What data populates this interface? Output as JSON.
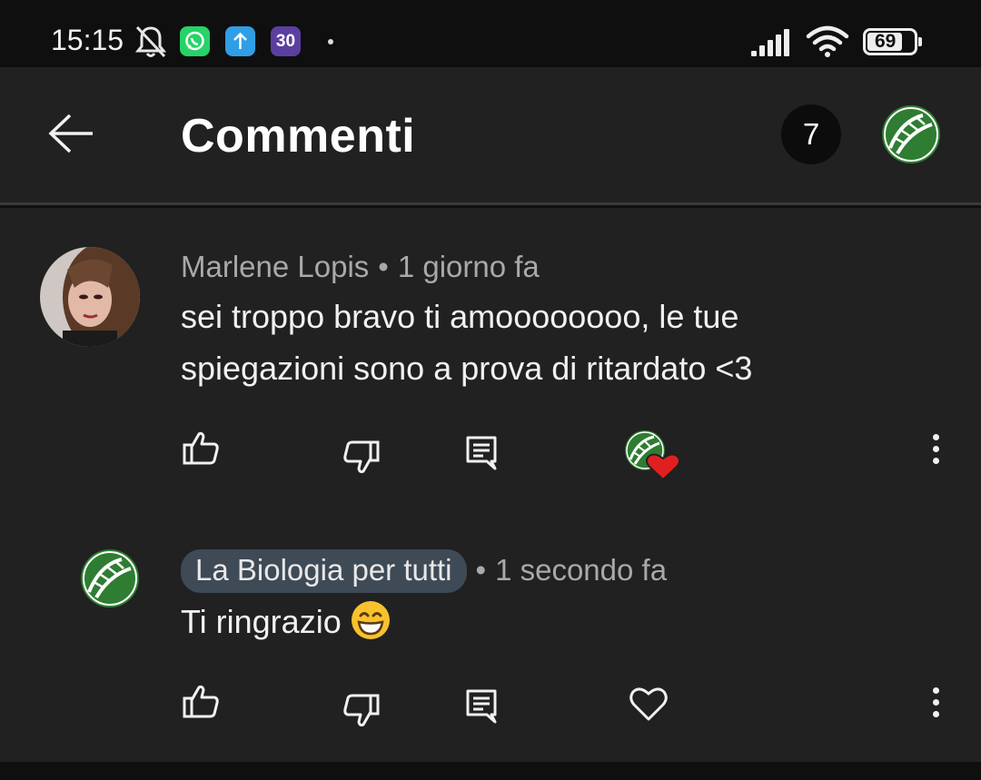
{
  "status_bar": {
    "time": "15:15",
    "app_icons": [
      {
        "name": "mute-bell-icon"
      },
      {
        "name": "whatsapp-icon",
        "color": "#25d366"
      },
      {
        "name": "upload-icon",
        "color": "#2f9ee6"
      },
      {
        "name": "app-30-icon",
        "label": "30",
        "color": "#5b3fa0"
      }
    ],
    "battery": "69"
  },
  "header": {
    "title": "Commenti",
    "count": "7"
  },
  "comments": [
    {
      "author": "Marlene Lopis",
      "separator": "•",
      "time": "1 giorno fa",
      "text": "sei troppo bravo ti amoooooooo, le tue spiegazioni sono a prova di ritardato <3",
      "creator_hearted": true
    },
    {
      "author": "La Biologia per tutti",
      "separator": "•",
      "time": "1 secondo fa",
      "text": "Ti ringrazio",
      "emoji": "grinning-face-icon",
      "creator_hearted": false
    }
  ],
  "colors": {
    "background": "#212121",
    "status_bar": "#0f0f0f",
    "channel_chip": "#3f4a57",
    "heart": "#e0201e",
    "channel_green": "#2e7d32"
  }
}
